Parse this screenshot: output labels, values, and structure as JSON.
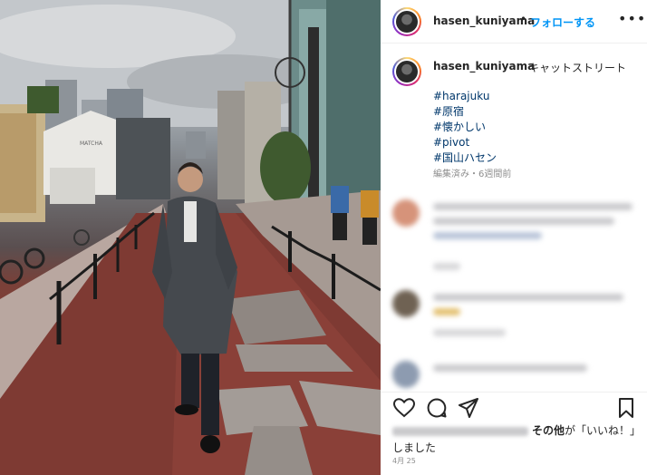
{
  "post": {
    "username": "hasen_kuniyama",
    "follow_label": "フォローする",
    "dot": "•",
    "more": "•••",
    "caption": "キャットストリート",
    "hashtags": [
      "#harajuku",
      "#原宿",
      "#懐かしい",
      "#pivot",
      "#国山ハセン"
    ],
    "meta": "編集済み・6週間前",
    "likes_suffix_1": "その他",
    "likes_suffix_2": "が「いいね！」しました",
    "date": "4月 25"
  },
  "icons": [
    "more-icon",
    "heart-icon",
    "comment-icon",
    "share-icon",
    "bookmark-icon"
  ],
  "colors": {
    "link": "#0095f6",
    "hashtag": "#00376b",
    "meta": "#8e8e8e"
  }
}
